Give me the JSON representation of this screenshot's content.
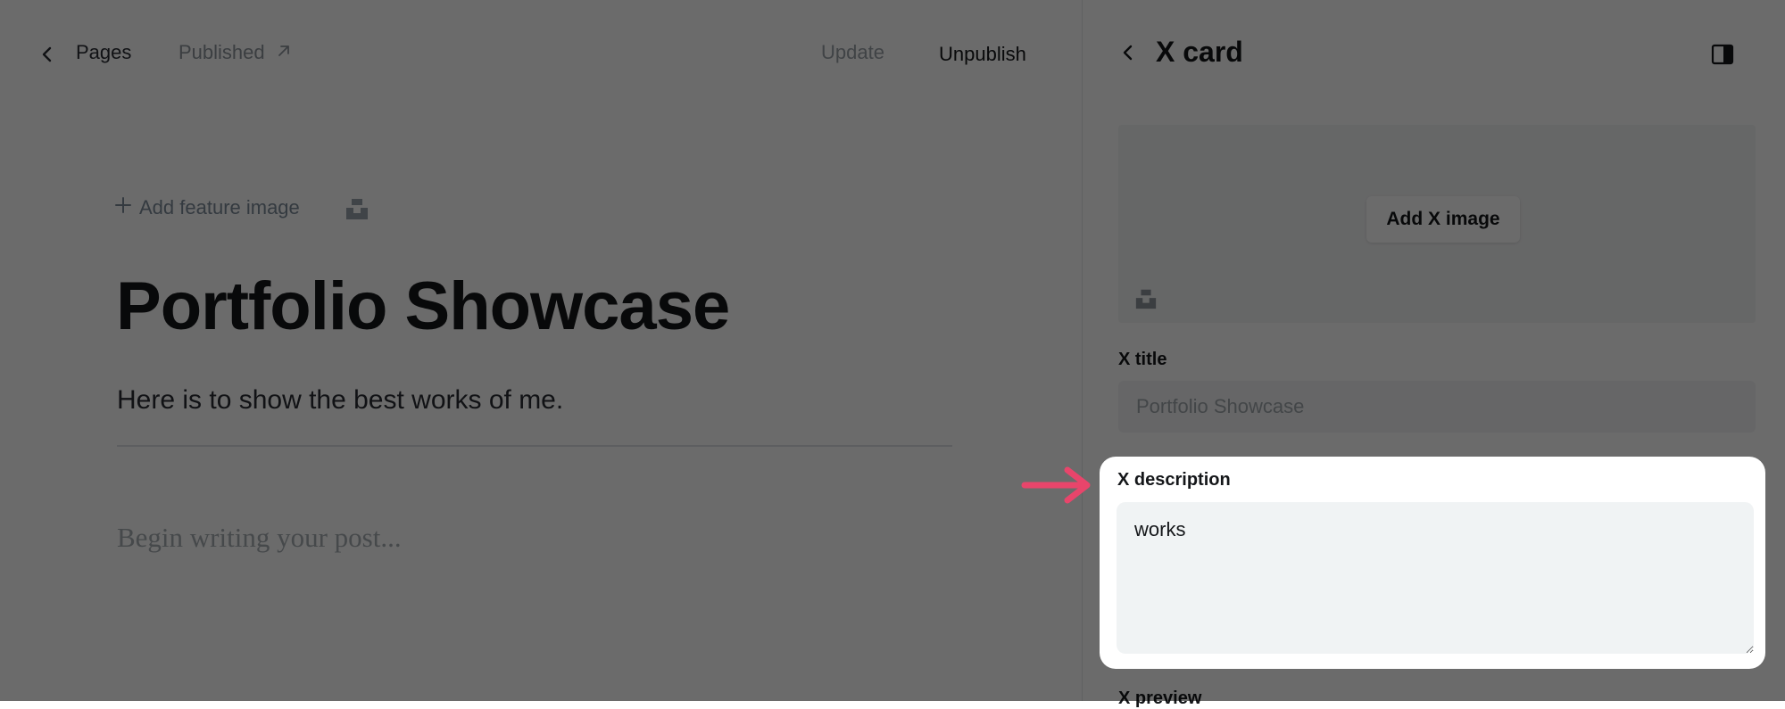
{
  "editor": {
    "back_label": "Pages",
    "status_label": "Published",
    "update_label": "Update",
    "unpublish_label": "Unpublish",
    "feature_image_label": "Add feature image",
    "post_title": "Portfolio Showcase",
    "post_excerpt": "Here is to show the best works of me.",
    "body_placeholder": "Begin writing your post..."
  },
  "panel": {
    "title": "X card",
    "add_image_label": "Add X image",
    "x_title_label": "X title",
    "x_title_placeholder": "Portfolio Showcase",
    "x_description_label": "X description",
    "x_description_value": "works",
    "x_preview_label": "X preview"
  },
  "colors": {
    "highlight_arrow": "#e8456b",
    "overlay": "#000000"
  },
  "icons": [
    "chevron-left-icon",
    "external-arrow-icon",
    "plus-icon",
    "unsplash-icon",
    "sidebar-toggle-icon",
    "arrow-right-icon"
  ]
}
